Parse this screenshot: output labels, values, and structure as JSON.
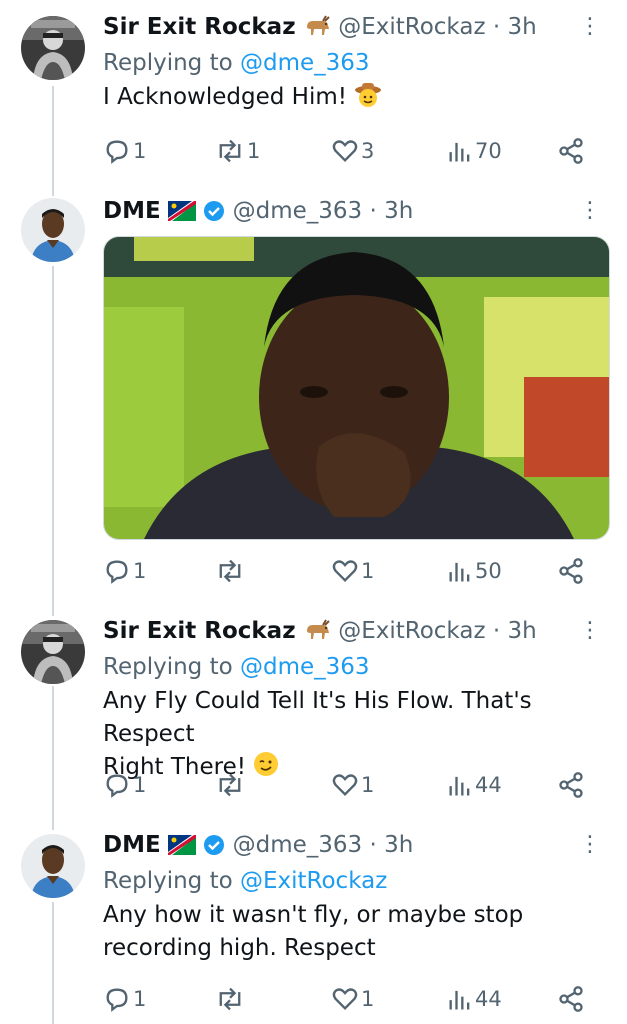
{
  "tweets": [
    {
      "name": "Sir Exit Rockaz",
      "name_emoji": "goat-emoji",
      "handle": "@ExitRockaz",
      "time": "· 3h",
      "reply_prefix": "Replying to",
      "reply_to": "@dme_363",
      "text": "I Acknowledged Him!",
      "text_emoji": "cowboy-emoji",
      "replies": "1",
      "retweets": "1",
      "likes": "3",
      "views": "70"
    },
    {
      "name": "DME",
      "name_emoji": "namibia-flag-emoji",
      "verified": true,
      "handle": "@dme_363",
      "time": "· 3h",
      "media": "photo",
      "replies": "1",
      "retweets": "",
      "likes": "1",
      "views": "50"
    },
    {
      "name": "Sir Exit Rockaz",
      "name_emoji": "goat-emoji",
      "handle": "@ExitRockaz",
      "time": "· 3h",
      "reply_prefix": "Replying to",
      "reply_to": "@dme_363",
      "text_line1": "Any Fly Could Tell It's His Flow. That's Respect",
      "text_line2": "Right There!",
      "text_emoji": "winking-face-emoji",
      "replies": "1",
      "retweets": "",
      "likes": "1",
      "views": "44"
    },
    {
      "name": "DME",
      "name_emoji": "namibia-flag-emoji",
      "verified": true,
      "handle": "@dme_363",
      "time": "· 3h",
      "reply_prefix": "Replying to",
      "reply_to": "@ExitRockaz",
      "text_line1": "Any how it wasn't fly, or maybe stop",
      "text_line2": "recording high. Respect",
      "replies": "1",
      "retweets": "",
      "likes": "1",
      "views": "44"
    }
  ],
  "colors": {
    "text": "#0f1419",
    "secondary": "#536471",
    "link": "#1d9bf0",
    "thread_line": "#cfd9de",
    "verified": "#1d9bf0"
  }
}
